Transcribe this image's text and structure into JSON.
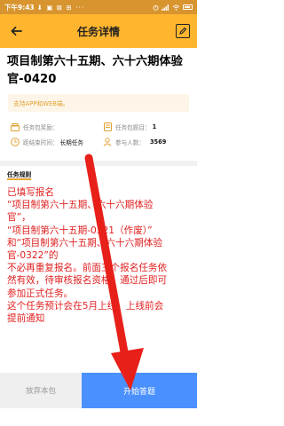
{
  "status_bar": {
    "time": "下午9:43",
    "left_icons": "⬇ ▣ ⊠ ⊞ ···"
  },
  "nav": {
    "title": "任务详情"
  },
  "task": {
    "title": "项目制第六十五期、六十六期体验官-0420"
  },
  "support_note": "支持APP和WEB端。",
  "info": {
    "reward_label": "任务包奖励：",
    "reward_value": "",
    "count_label": "任务包题目：",
    "count_value": "1",
    "deadline_label": "距结束时间：",
    "deadline_value": "长期任务",
    "participants_label": "参与人数：",
    "participants_value": "3569"
  },
  "rules": {
    "label": "任务规则",
    "lines": [
      "已填写报名",
      "“项目制第六十五期、六十六期体验",
      "官”，",
      "“项目制第六十五期-0321（作废）”",
      "和“项目制第六十五期、六十六期体验",
      "官-0322”的",
      "不必再重复报名。前面三个报名任务依",
      "然有效，待审核报名资格，通过后即可",
      "参加正式任务。",
      "这个任务预计会在5月上线，上线前会",
      "提前通知"
    ]
  },
  "buttons": {
    "give_up": "放弃本包",
    "start": "开始答题"
  },
  "colors": {
    "header": "#ffb52e",
    "status_bar": "#d8942e",
    "rules_text": "#e02020",
    "start_button": "#4a90ff",
    "annotation_arrow": "#e8201a"
  }
}
